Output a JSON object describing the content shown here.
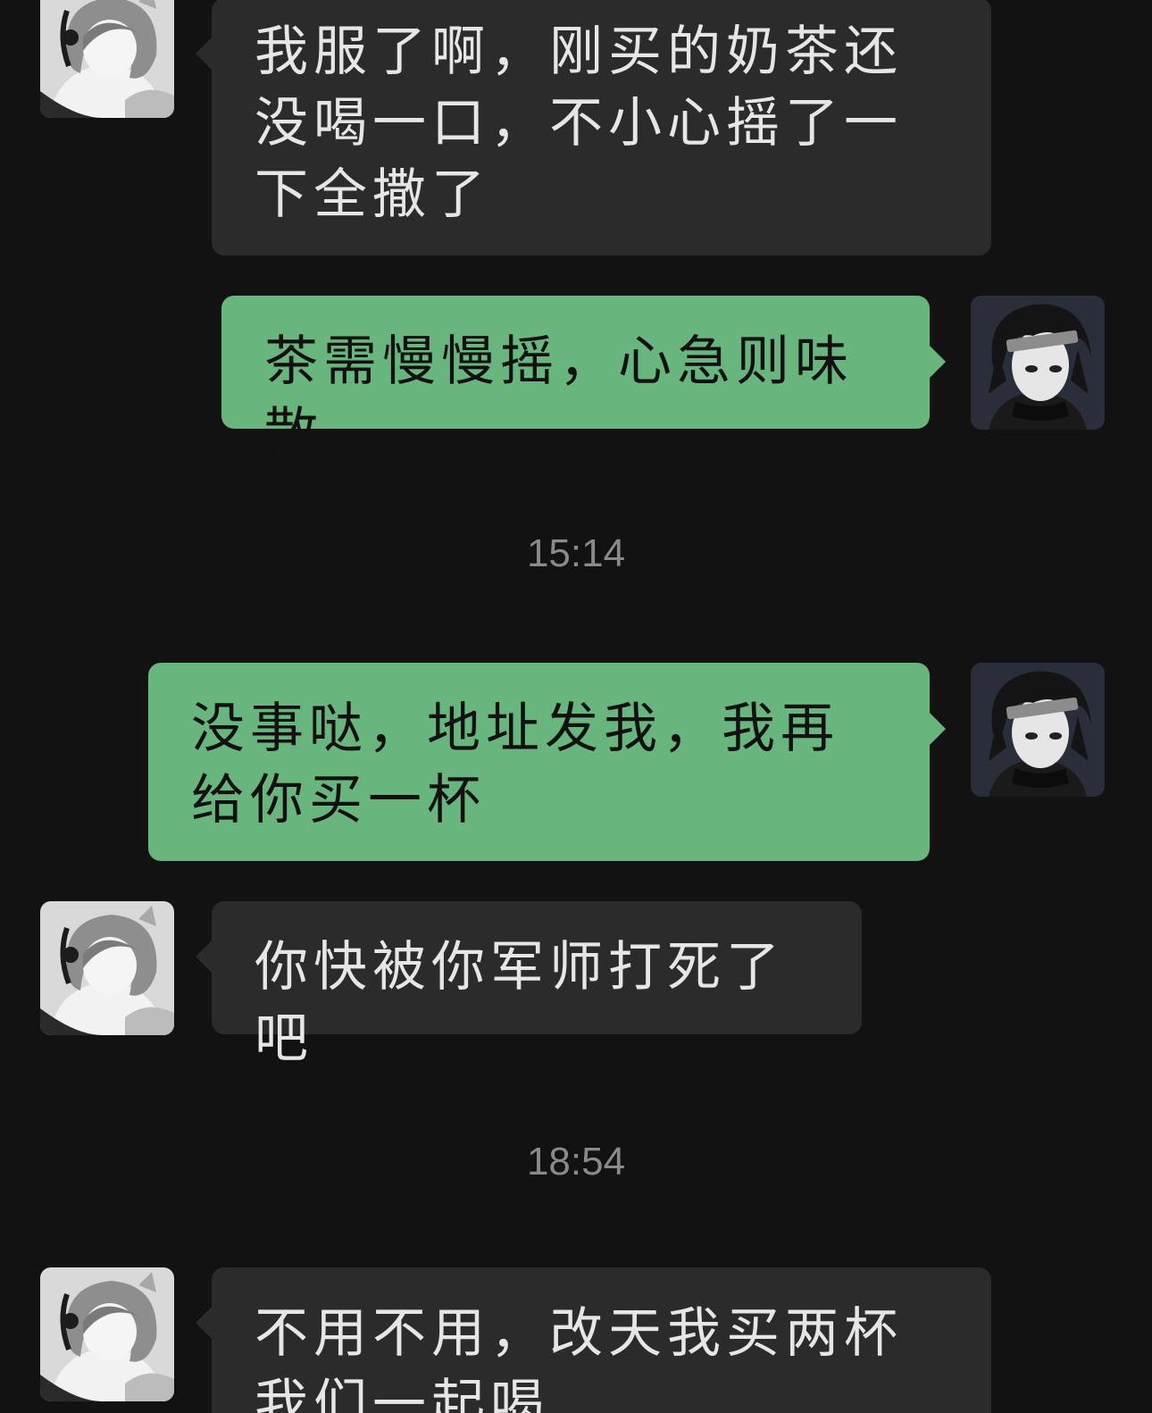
{
  "messages": [
    {
      "sender": "left",
      "text": "我服了啊，刚买的奶茶还没喝一口，不小心摇了一下全撒了"
    },
    {
      "sender": "right",
      "text": "茶需慢慢摇，心急则味散"
    },
    {
      "sender": "right",
      "text": "没事哒，地址发我，我再给你买一杯"
    },
    {
      "sender": "left",
      "text": "你快被你军师打死了吧"
    },
    {
      "sender": "left",
      "text": "不用不用，改天我买两杯我们一起喝"
    }
  ],
  "timestamps": [
    "15:14",
    "18:54"
  ],
  "avatars": {
    "left": "anime-girl-headphones-avatar",
    "right": "anime-ninja-headband-avatar"
  },
  "colors": {
    "background": "#121212",
    "incoming_bubble": "#2b2b2b",
    "outgoing_bubble": "#68b57d",
    "timestamp": "#8a8a8a"
  }
}
